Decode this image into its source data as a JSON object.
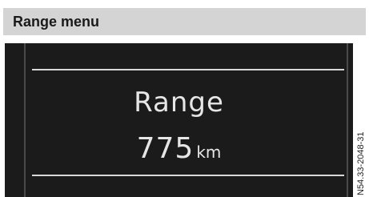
{
  "header": {
    "title": "Range menu"
  },
  "display": {
    "label": "Range",
    "value": "775",
    "unit": "km"
  },
  "figure_code": "N54.33-2048-31",
  "colors": {
    "header_bg": "#d4d4d4",
    "display_bg": "#1b1b1b",
    "display_text": "#e6e6e6"
  }
}
